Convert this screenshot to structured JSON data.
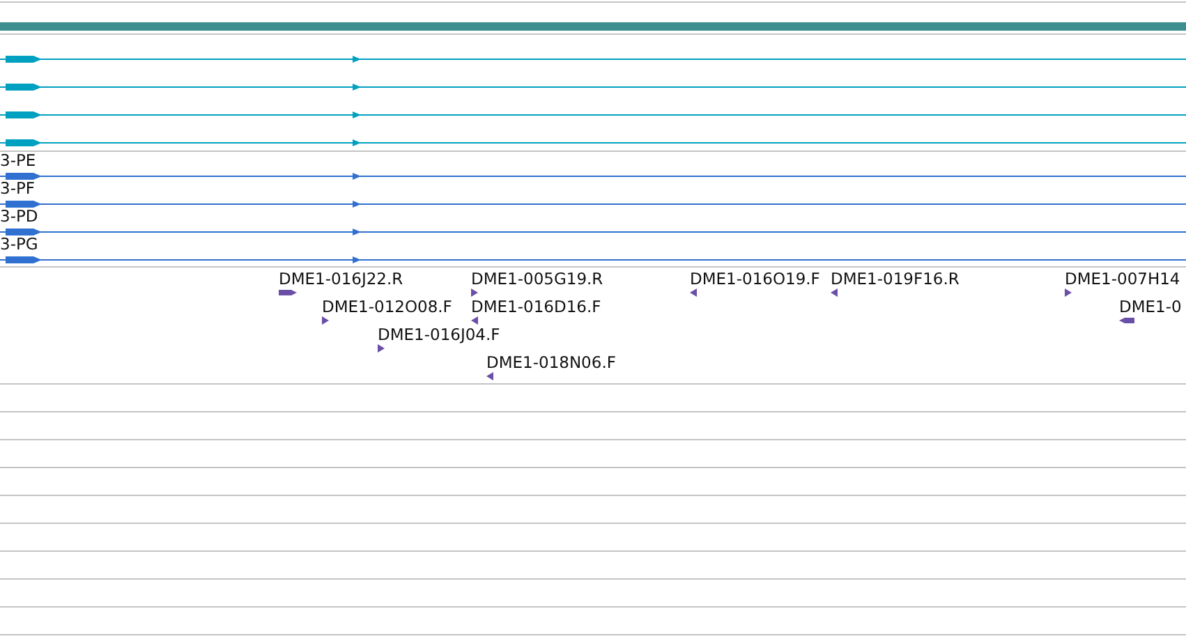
{
  "transcript_track": {
    "transcripts": [
      {
        "reverse": false
      },
      {
        "reverse": false
      },
      {
        "reverse": false
      },
      {
        "reverse": false
      }
    ]
  },
  "gene_track": {
    "transcripts": [
      {
        "label": "3-PE",
        "reverse": false
      },
      {
        "label": "3-PF",
        "reverse": false
      },
      {
        "label": "3-PD",
        "reverse": false
      },
      {
        "label": "3-PG",
        "reverse": false
      }
    ]
  },
  "clone_track": {
    "clones": [
      {
        "label": "DME1-016J22.R",
        "reverse": false
      },
      {
        "label": "DME1-012O08.F",
        "reverse": false
      },
      {
        "label": "DME1-016J04.F",
        "reverse": false
      },
      {
        "label": "DME1-005G19.R",
        "reverse": false
      },
      {
        "label": "DME1-016D16.F",
        "reverse": true
      },
      {
        "label": "DME1-018N06.F",
        "reverse": true
      },
      {
        "label": "DME1-016O19.F",
        "reverse": true
      },
      {
        "label": "DME1-019F16.R",
        "reverse": true
      },
      {
        "label": "DME1-007H14",
        "reverse": false
      },
      {
        "label": "DME1-0",
        "reverse": true
      }
    ]
  }
}
